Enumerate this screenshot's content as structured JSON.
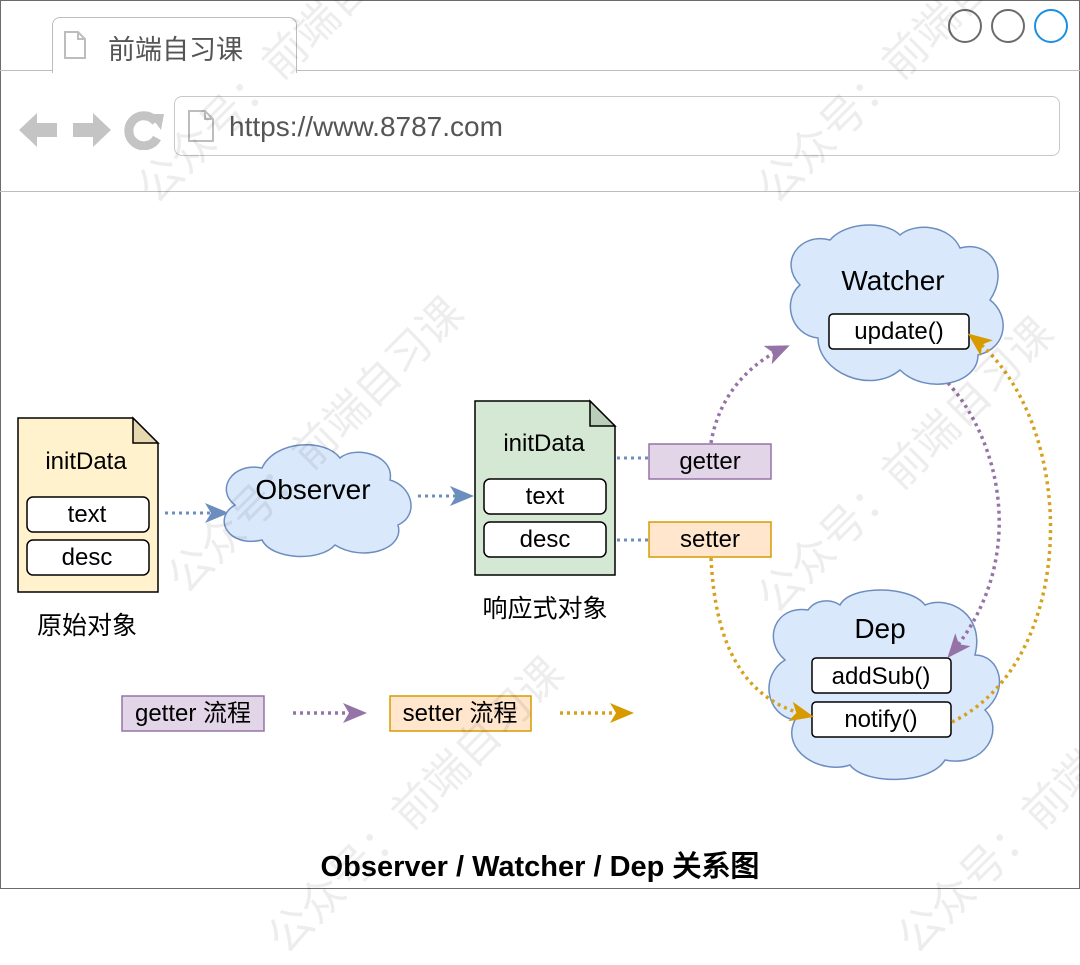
{
  "browser": {
    "tab_title": "前端自习课",
    "url": "https://www.8787.com",
    "window_buttons": [
      "minimize-button",
      "maximize-button",
      "close-button"
    ],
    "nav_icons": [
      "back-arrow-icon",
      "forward-arrow-icon",
      "reload-icon",
      "page-icon"
    ],
    "accent_color": "#1a8fe3"
  },
  "diagram": {
    "raw_object": {
      "title": "initData",
      "fields": [
        "text",
        "desc"
      ],
      "caption": "原始对象",
      "fill": "#fff2cc",
      "stroke": "#000000"
    },
    "observer": {
      "label": "Observer",
      "fill": "#dae8fc",
      "stroke": "#6c8ebf"
    },
    "reactive_object": {
      "title": "initData",
      "fields": [
        "text",
        "desc"
      ],
      "caption": "响应式对象",
      "fill": "#d5e8d4"
    },
    "getter": {
      "label": "getter",
      "fill": "#e1d5e7",
      "stroke": "#9673a6"
    },
    "setter": {
      "label": "setter",
      "fill": "#ffe6cc",
      "stroke": "#d79b00"
    },
    "watcher": {
      "label": "Watcher",
      "methods": [
        "update()"
      ]
    },
    "dep": {
      "label": "Dep",
      "methods": [
        "addSub()",
        "notify()"
      ]
    },
    "legend": {
      "getter_flow": "getter 流程",
      "setter_flow": "setter 流程",
      "getter_color": "#9673a6",
      "setter_color": "#d6a21d"
    },
    "title": "Observer / Watcher / Dep 关系图"
  },
  "watermark": "公众号：前端自习课"
}
